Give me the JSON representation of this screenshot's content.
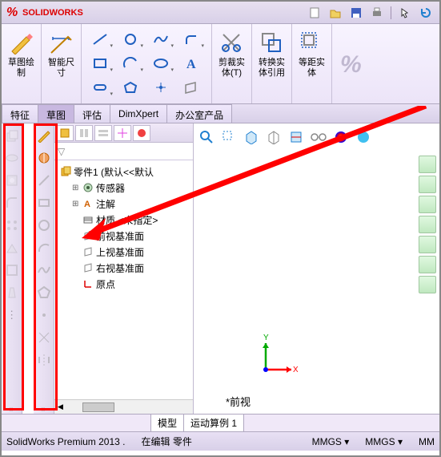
{
  "app": {
    "name": "SOLIDWORKS"
  },
  "ribbon": {
    "sketch_draw": "草图绘制",
    "smart_dim": "智能尺寸",
    "trim": "剪裁实体(T)",
    "convert": "转换实体引用",
    "offset": "等距实体"
  },
  "tabs": [
    "特征",
    "草图",
    "评估",
    "DimXpert",
    "办公室产品"
  ],
  "active_tab": 1,
  "tree": {
    "root": "零件1  (默认<<默认",
    "items": [
      {
        "icon": "sensor",
        "label": "传感器"
      },
      {
        "icon": "annot",
        "label": "注解"
      },
      {
        "icon": "material",
        "label": "材质 <未指定>"
      },
      {
        "icon": "plane",
        "label": "前视基准面"
      },
      {
        "icon": "plane",
        "label": "上视基准面"
      },
      {
        "icon": "plane",
        "label": "右视基准面"
      },
      {
        "icon": "origin",
        "label": "原点"
      }
    ]
  },
  "viewport": {
    "view_name": "*前视",
    "axis_x": "X",
    "axis_y": "Y"
  },
  "bottom_tabs": [
    "模型",
    "运动算例 1"
  ],
  "status": {
    "product": "SolidWorks Premium 2013 .",
    "mode": "在编辑 零件",
    "units1": "MMGS",
    "units2": "MMGS",
    "units3": "MM"
  },
  "colors": {
    "highlight": "#ff0000",
    "axis_x": "#ff0000",
    "axis_y": "#00aa00",
    "axis_z": "#0000ff"
  }
}
